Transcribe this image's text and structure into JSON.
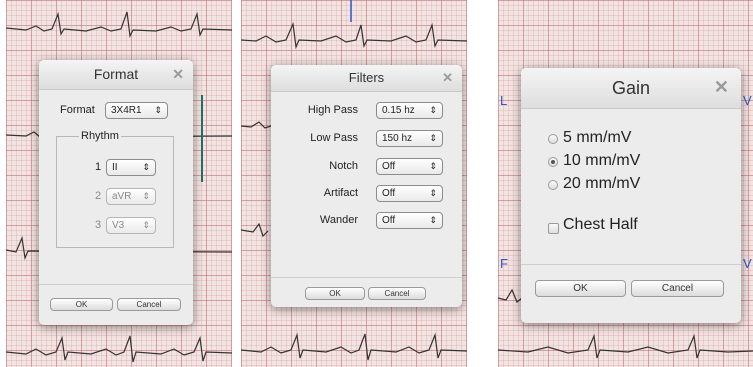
{
  "format_dialog": {
    "title": "Format",
    "close_icon": "close-icon",
    "format_label": "Format",
    "format_value": "3X4R1",
    "rhythm_legend": "Rhythm",
    "rhythm": [
      {
        "index": "1",
        "value": "II",
        "enabled": true
      },
      {
        "index": "2",
        "value": "aVR",
        "enabled": false
      },
      {
        "index": "3",
        "value": "V3",
        "enabled": false
      }
    ],
    "ok_label": "OK",
    "cancel_label": "Cancel"
  },
  "filters_dialog": {
    "title": "Filters",
    "close_icon": "close-icon",
    "rows": [
      {
        "label": "High Pass",
        "value": "0.15 hz"
      },
      {
        "label": "Low Pass",
        "value": "150 hz"
      },
      {
        "label": "Notch",
        "value": "Off"
      },
      {
        "label": "Artifact",
        "value": "Off"
      },
      {
        "label": "Wander",
        "value": "Off"
      }
    ],
    "ok_label": "OK",
    "cancel_label": "Cancel"
  },
  "gain_dialog": {
    "title": "Gain",
    "close_icon": "close-icon",
    "options": [
      {
        "label": "5 mm/mV",
        "selected": false
      },
      {
        "label": "10 mm/mV",
        "selected": true
      },
      {
        "label": "20 mm/mV",
        "selected": false
      }
    ],
    "chest_half_label": "Chest Half",
    "chest_half_checked": false,
    "ok_label": "OK",
    "cancel_label": "Cancel"
  },
  "background": {
    "grid_color": "#c47878",
    "paper_color": "#f2e4e2",
    "trace_color": "#333333",
    "lead_letter_color": "#2a59c9",
    "lead_letters": [
      "L",
      "F",
      "V",
      "V"
    ]
  }
}
